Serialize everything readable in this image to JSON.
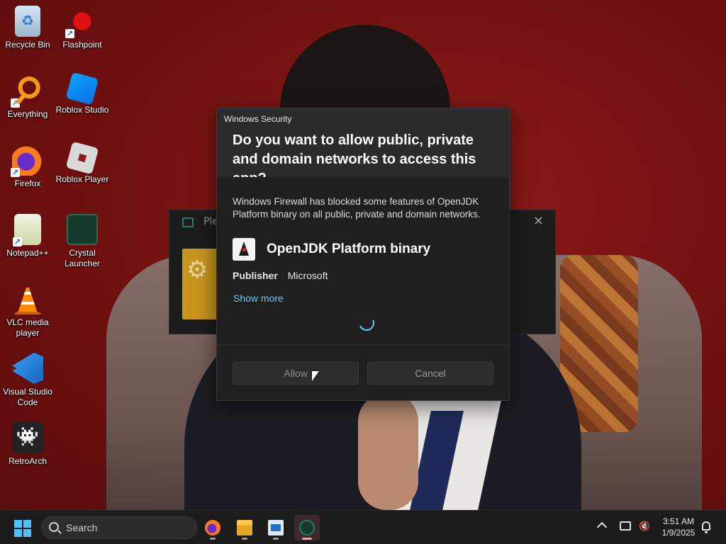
{
  "desktop": {
    "icons": [
      {
        "label": "Recycle Bin",
        "icon": "recycle-bin-icon"
      },
      {
        "label": "Flashpoint",
        "icon": "flashpoint-icon"
      },
      {
        "label": "Everything",
        "icon": "everything-search-icon"
      },
      {
        "label": "Roblox Studio",
        "icon": "roblox-studio-icon"
      },
      {
        "label": "Firefox",
        "icon": "firefox-icon"
      },
      {
        "label": "Roblox Player",
        "icon": "roblox-player-icon"
      },
      {
        "label": "Notepad++",
        "icon": "notepad-plus-plus-icon"
      },
      {
        "label": "Crystal Launcher",
        "icon": "crystal-launcher-icon"
      },
      {
        "label": "VLC media player",
        "icon": "vlc-icon"
      },
      {
        "label": "Visual Studio Code",
        "icon": "vscode-icon"
      },
      {
        "label": "RetroArch",
        "icon": "retroarch-icon"
      }
    ]
  },
  "background_window": {
    "title": "Ple",
    "close_glyph": "✕"
  },
  "dialog": {
    "caption": "Windows Security",
    "question": "Do you want to allow public, private and domain networks to access this app?",
    "description": "Windows Firewall has blocked some features of OpenJDK Platform binary on all public, private and domain networks.",
    "app_name": "OpenJDK Platform binary",
    "publisher_label": "Publisher",
    "publisher_value": "Microsoft",
    "show_more": "Show more",
    "allow_label": "Allow",
    "cancel_label": "Cancel"
  },
  "taskbar": {
    "search_placeholder": "Search",
    "time": "3:51 AM",
    "date": "1/9/2025",
    "accent": "#4cc2ff"
  }
}
